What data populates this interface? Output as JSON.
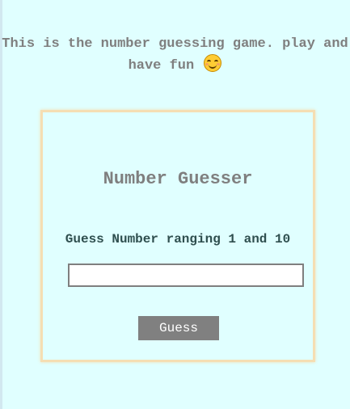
{
  "intro": {
    "text": "This is the number guessing game. play and have fun"
  },
  "icons": {
    "emoji": "smiling-face-icon"
  },
  "game": {
    "title": "Number Guesser",
    "prompt": "Guess Number ranging 1 and 10",
    "input_value": "",
    "button_label": "Guess"
  },
  "colors": {
    "background": "#e0ffff",
    "card_border": "#f5deb3",
    "muted_text": "#7f7f7f",
    "prompt_text": "#2f4f4f",
    "button_bg": "#808080"
  }
}
